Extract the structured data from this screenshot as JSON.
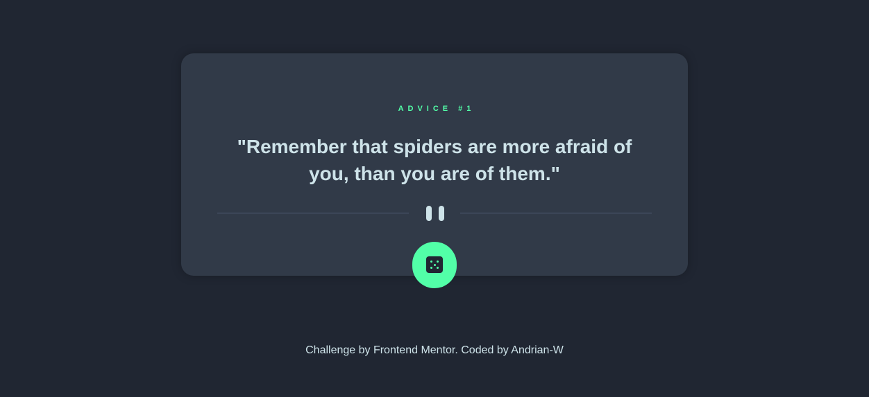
{
  "card": {
    "advice_label": "ADVICE #1",
    "quote": "\"Remember that spiders are more afraid of you, than you are of them.\""
  },
  "dice_button": {
    "icon": "dice-icon"
  },
  "divider": {
    "icon": "pause-icon"
  },
  "footer": {
    "text": "Challenge by Frontend Mentor. Coded by Andrian-W"
  },
  "colors": {
    "background": "#202632",
    "card": "#313a48",
    "accent": "#52ffa8",
    "text": "#cee3e9",
    "divider": "#4f5d74"
  }
}
